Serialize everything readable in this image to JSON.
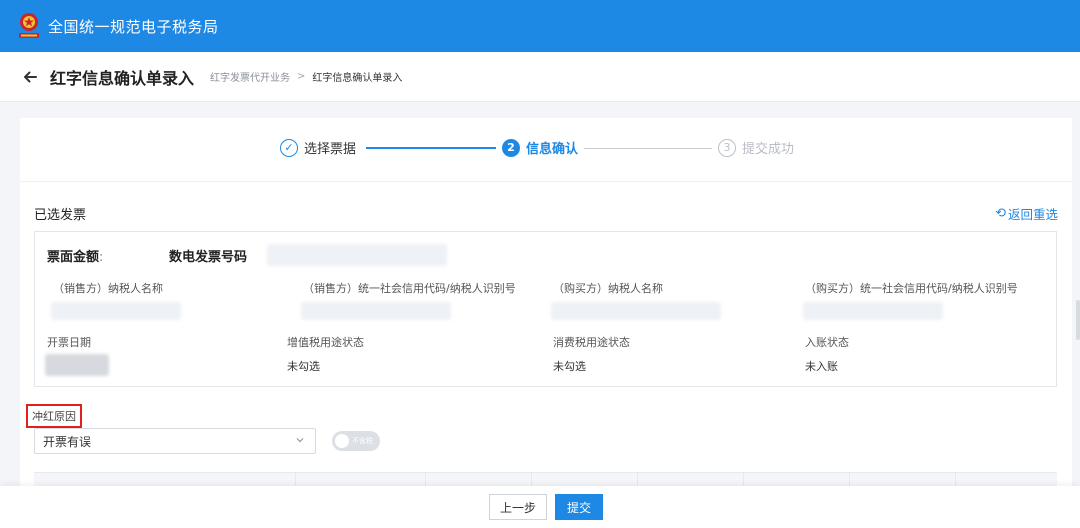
{
  "app": {
    "title": "全国统一规范电子税务局",
    "emblem_icon": "national-emblem-icon"
  },
  "header": {
    "title": "红字信息确认单录入",
    "breadcrumb": [
      {
        "label": "红字发票代开业务"
      },
      {
        "label": "红字信息确认单录入"
      }
    ],
    "separator": ">"
  },
  "steps": [
    {
      "num": "✓",
      "label": "选择票据",
      "state": "done"
    },
    {
      "num": "2",
      "label": "信息确认",
      "state": "active"
    },
    {
      "num": "3",
      "label": "提交成功",
      "state": "pending"
    }
  ],
  "selected": {
    "title": "已选发票",
    "reselect_label": "返回重选",
    "reselect_icon": "undo-icon",
    "amount_label": "票面金额",
    "amount_colon": ":",
    "number_label": "数电发票号码",
    "fields_row1": [
      {
        "label": "（销售方）纳税人名称"
      },
      {
        "label": "（销售方）统一社会信用代码/纳税人识别号"
      },
      {
        "label": "（购买方）纳税人名称"
      },
      {
        "label": "（购买方）统一社会信用代码/纳税人识别号"
      }
    ],
    "fields_row2": [
      {
        "label": "开票日期",
        "value": ""
      },
      {
        "label": "增值税用途状态",
        "value": "未勾选"
      },
      {
        "label": "消费税用途状态",
        "value": "未勾选"
      },
      {
        "label": "入账状态",
        "value": "未入账"
      }
    ]
  },
  "reason": {
    "label": "冲红原因",
    "selected": "开票有误",
    "toggle_text": "不含税"
  },
  "footer": {
    "prev_label": "上一步",
    "submit_label": "提交"
  },
  "colors": {
    "primary": "#1e88e5",
    "highlight": "#e02020"
  }
}
